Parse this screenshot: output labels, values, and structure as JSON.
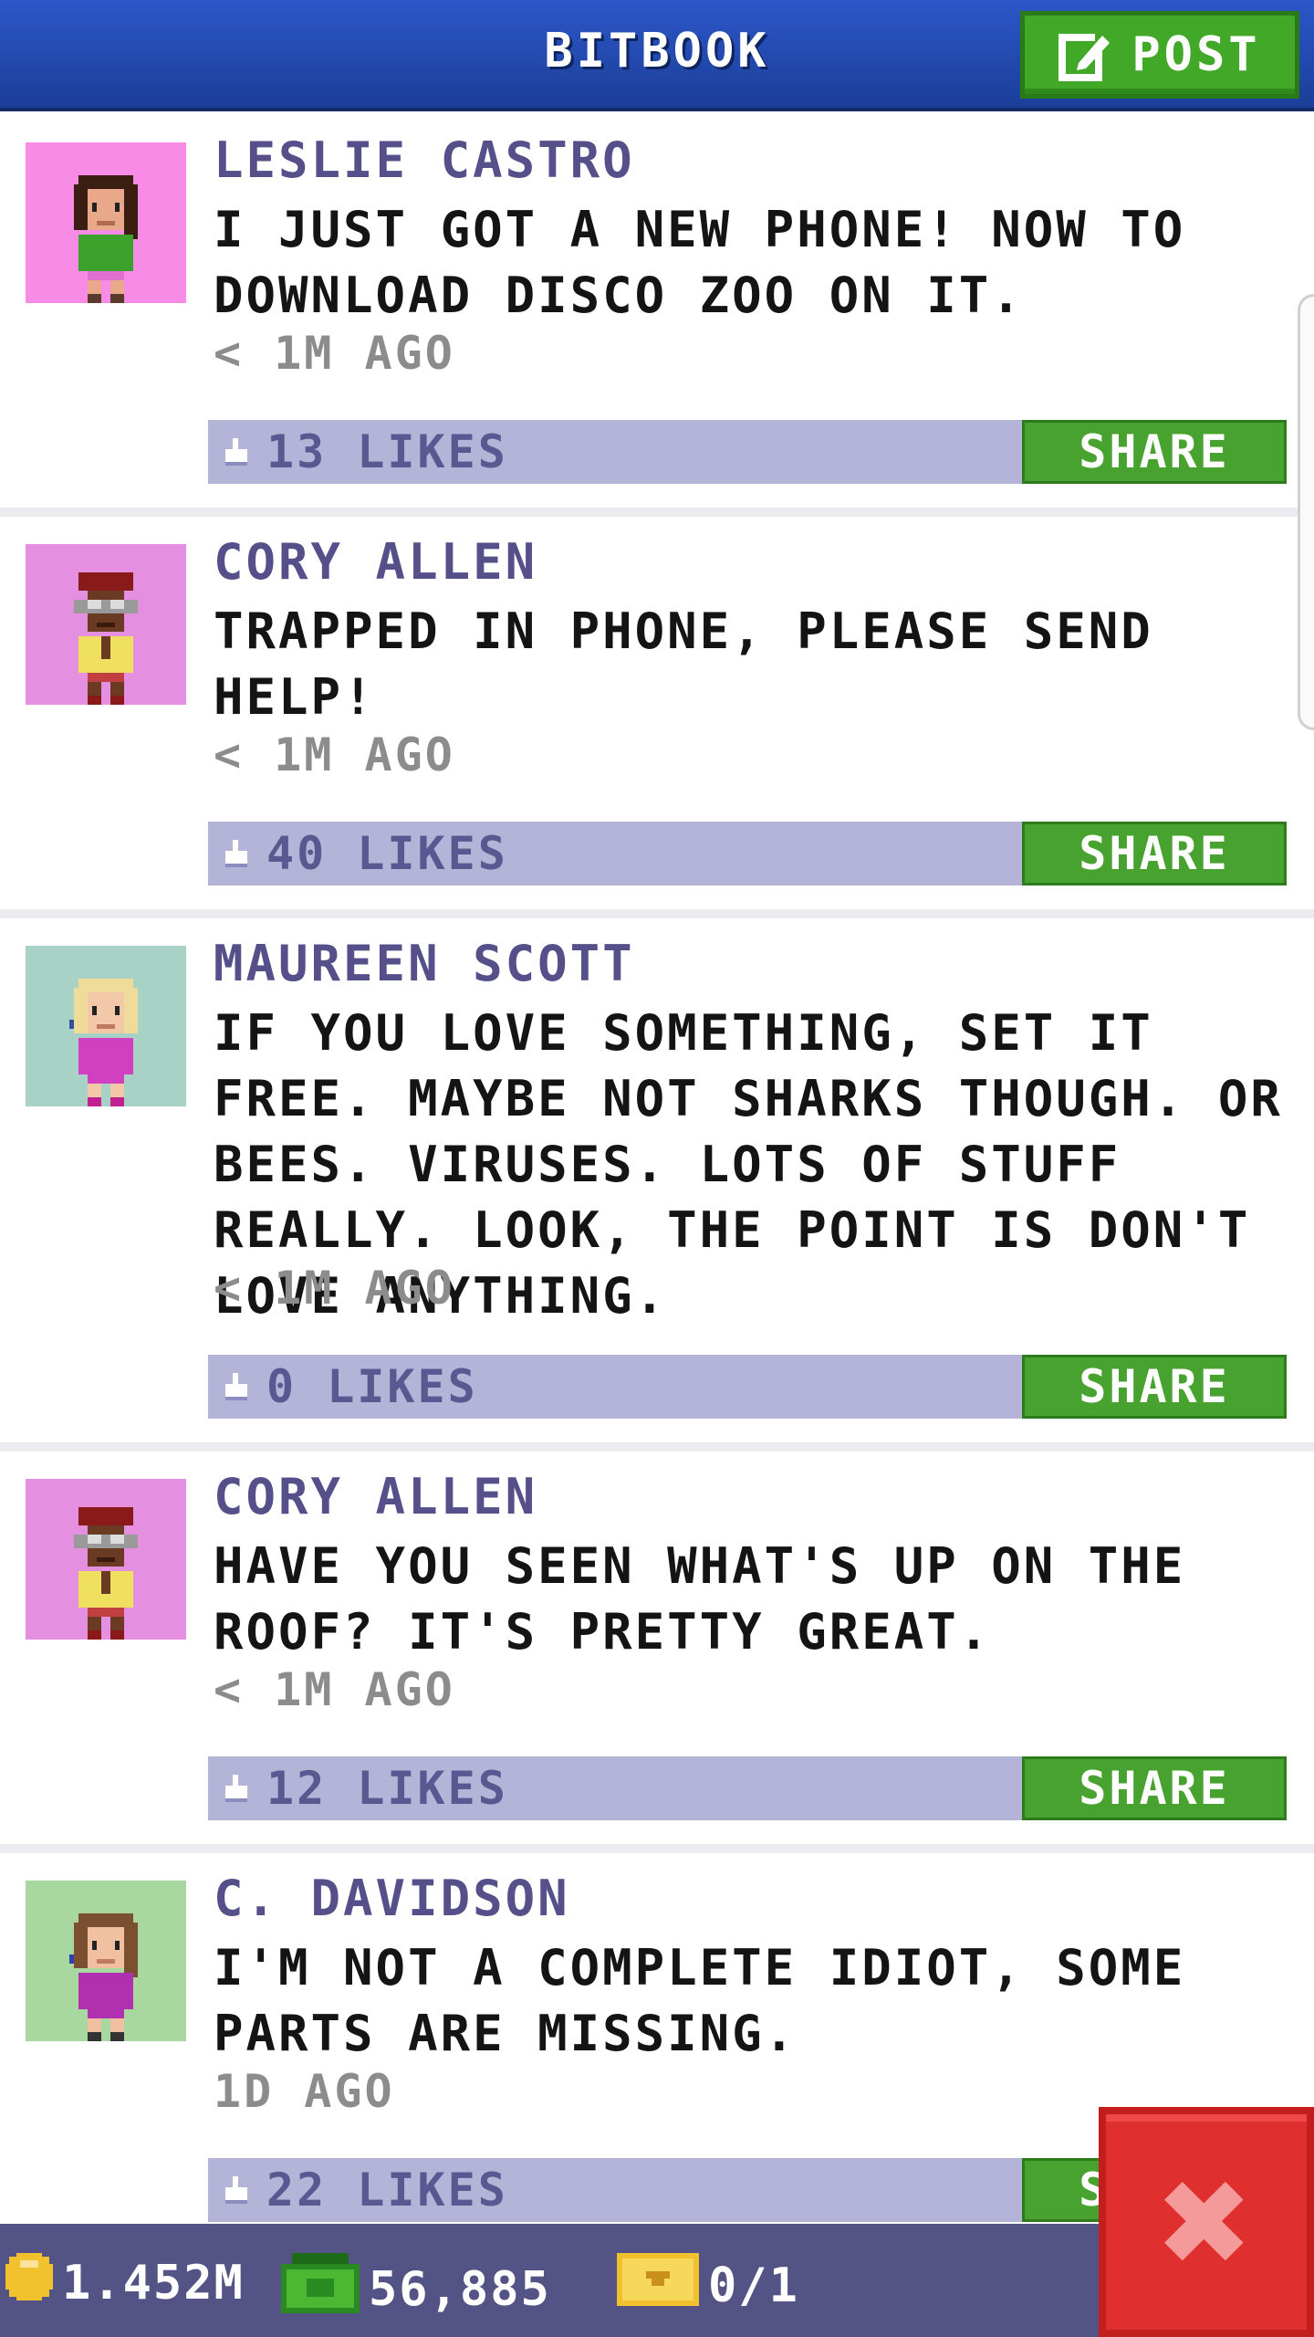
{
  "header": {
    "title": "BITBOOK",
    "post_label": "POST"
  },
  "posts": [
    {
      "author": "LESLIE CASTRO",
      "text": "I JUST GOT A NEW PHONE! NOW TO DOWNLOAD DISCO ZOO ON IT.",
      "time": "< 1M AGO",
      "likes": "13 LIKES",
      "share": "SHARE",
      "avatar_bg": "#f78be6"
    },
    {
      "author": "CORY ALLEN",
      "text": "TRAPPED IN PHONE, PLEASE SEND HELP!",
      "time": "< 1M AGO",
      "likes": "40 LIKES",
      "share": "SHARE",
      "avatar_bg": "#e58fe0"
    },
    {
      "author": "MAUREEN SCOTT",
      "text": "IF YOU LOVE SOMETHING, SET IT FREE. MAYBE NOT SHARKS THOUGH. OR BEES. VIRUSES. LOTS OF STUFF REALLY. LOOK, THE POINT IS DON'T LOVE ANYTHING.",
      "time": "< 1M AGO",
      "likes": "0 LIKES",
      "share": "SHARE",
      "avatar_bg": "#a9d2c6"
    },
    {
      "author": "CORY ALLEN",
      "text": "HAVE YOU SEEN WHAT'S UP ON THE ROOF? IT'S PRETTY GREAT.",
      "time": "< 1M AGO",
      "likes": "12 LIKES",
      "share": "SHARE",
      "avatar_bg": "#e58fe0"
    },
    {
      "author": "C. DAVIDSON",
      "text": "I'M NOT A COMPLETE IDIOT, SOME PARTS ARE MISSING.",
      "time": "1D AGO",
      "likes": "22 LIKES",
      "share": "SHARE",
      "avatar_bg": "#a8d8a0"
    }
  ],
  "footer": {
    "coins": "1.452M",
    "cash": "56,885",
    "tickets": "0/1"
  },
  "colors": {
    "header": "#2148b0",
    "post_button": "#41a828",
    "share_button": "#48a230",
    "likes_bar": "#b4b4d8",
    "footer": "#535386",
    "close_button": "#e02f2f"
  }
}
